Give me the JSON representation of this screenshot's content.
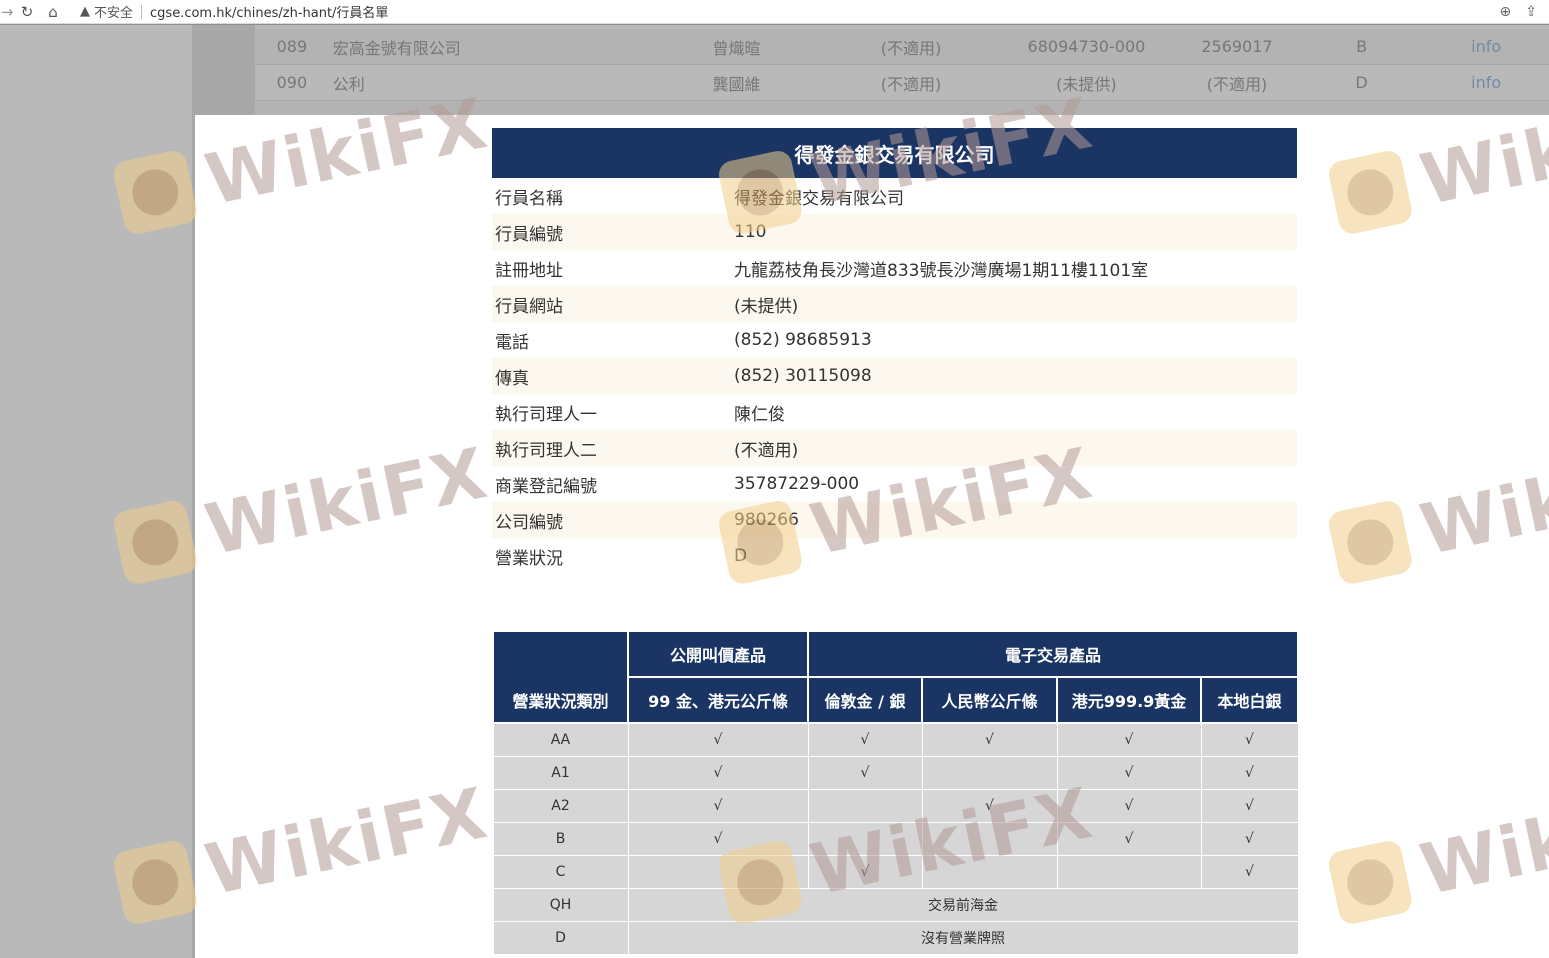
{
  "browser": {
    "security_label": "不安全",
    "url": "cgse.com.hk/chines/zh-hant/行員名單"
  },
  "background_list": {
    "rows": [
      {
        "no": "089",
        "name": "宏高金號有限公司",
        "person": "曾熾暄",
        "person2": "(不適用)",
        "br": "68094730-000",
        "company_no": "2569017",
        "status": "B",
        "link": "info"
      },
      {
        "no": "090",
        "name": "公利",
        "person": "龔國維",
        "person2": "(不適用)",
        "br": "(未提供)",
        "company_no": "(不適用)",
        "status": "D",
        "link": "info"
      }
    ]
  },
  "member": {
    "title": "得發金銀交易有限公司",
    "fields": [
      {
        "label": "行員名稱",
        "value": "得發金銀交易有限公司"
      },
      {
        "label": "行員編號",
        "value": "110"
      },
      {
        "label": "註冊地址",
        "value": "九龍荔枝角長沙灣道833號長沙灣廣場1期11樓1101室"
      },
      {
        "label": "行員網站",
        "value": "(未提供)"
      },
      {
        "label": "電話",
        "value": "(852) 98685913"
      },
      {
        "label": "傳真",
        "value": "(852) 30115098"
      },
      {
        "label": "執行司理人一",
        "value": "陳仁俊"
      },
      {
        "label": "執行司理人二",
        "value": "(不適用)"
      },
      {
        "label": "商業登記編號",
        "value": "35787229-000"
      },
      {
        "label": "公司編號",
        "value": "980266"
      },
      {
        "label": "營業狀況",
        "value": "D"
      }
    ]
  },
  "grade_table": {
    "corner": "營業狀況類別",
    "group_public": "公開叫價產品",
    "group_electronic": "電子交易產品",
    "col_public": "99 金、港元公斤條",
    "col_e1": "倫敦金 / 銀",
    "col_e2": "人民幣公斤條",
    "col_e3": "港元999.9黃金",
    "col_e4": "本地白銀",
    "rows": [
      {
        "code": "AA",
        "cells": [
          "√",
          "√",
          "√",
          "√",
          "√"
        ]
      },
      {
        "code": "A1",
        "cells": [
          "√",
          "√",
          "",
          "√",
          "√"
        ]
      },
      {
        "code": "A2",
        "cells": [
          "√",
          "",
          "√",
          "√",
          "√"
        ]
      },
      {
        "code": "B",
        "cells": [
          "√",
          "",
          "",
          "√",
          "√"
        ]
      },
      {
        "code": "C",
        "cells": [
          "",
          "√",
          "",
          "",
          "√"
        ]
      }
    ],
    "qh": {
      "code": "QH",
      "text": "交易前海金"
    },
    "d": {
      "code": "D",
      "text": "沒有營業牌照"
    }
  },
  "watermark": {
    "text": "WikiFX"
  }
}
